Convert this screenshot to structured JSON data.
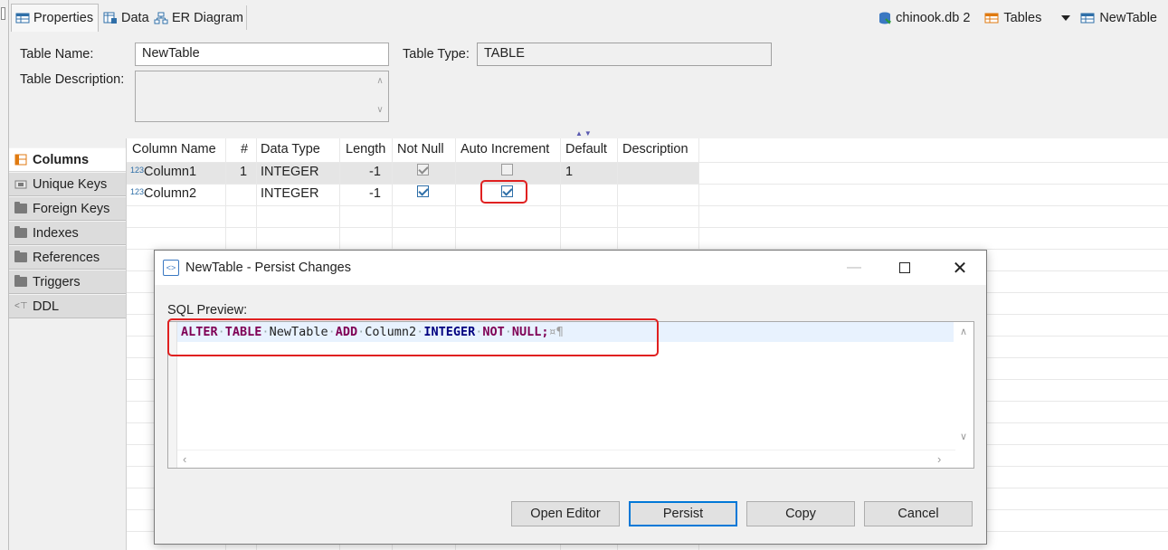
{
  "tabs": [
    {
      "label": "Properties",
      "icon": "table-icon"
    },
    {
      "label": "Data",
      "icon": "data-grid-icon"
    },
    {
      "label": "ER Diagram",
      "icon": "er-diagram-icon"
    }
  ],
  "breadcrumb": {
    "db": "chinook.db 2",
    "folder": "Tables",
    "table": "NewTable"
  },
  "form": {
    "table_name_label": "Table Name:",
    "table_name_value": "NewTable",
    "table_type_label": "Table Type:",
    "table_type_value": "TABLE",
    "table_description_label": "Table Description:",
    "table_description_value": ""
  },
  "sidenav": {
    "items": [
      {
        "label": "Columns",
        "icon": "columns-icon",
        "active": true
      },
      {
        "label": "Unique Keys",
        "icon": "key-icon",
        "active": false
      },
      {
        "label": "Foreign Keys",
        "icon": "folder-icon",
        "active": false
      },
      {
        "label": "Indexes",
        "icon": "folder-icon",
        "active": false
      },
      {
        "label": "References",
        "icon": "folder-icon",
        "active": false
      },
      {
        "label": "Triggers",
        "icon": "folder-icon",
        "active": false
      },
      {
        "label": "DDL",
        "icon": "ddl-icon",
        "active": false
      }
    ]
  },
  "grid": {
    "headers": [
      "Column Name",
      "#",
      "Data Type",
      "Length",
      "Not Null",
      "Auto Increment",
      "Default",
      "Description"
    ],
    "rows": [
      {
        "type_badge": "123",
        "name": "Column1",
        "ordinal": "1",
        "data_type": "INTEGER",
        "length": "-1",
        "not_null": true,
        "auto_increment": false,
        "default": "1",
        "description": ""
      },
      {
        "type_badge": "123",
        "name": "Column2",
        "ordinal": "",
        "data_type": "INTEGER",
        "length": "-1",
        "not_null": true,
        "auto_increment": true,
        "default": "",
        "description": ""
      }
    ]
  },
  "dialog": {
    "title": "NewTable - Persist Changes",
    "sql_label": "SQL Preview:",
    "sql": {
      "kw_alter": "ALTER",
      "kw_table": "TABLE",
      "table": "NewTable",
      "kw_add": "ADD",
      "column": "Column2",
      "kw_integer": "INTEGER",
      "kw_not": "NOT",
      "kw_null": "NULL",
      "semicolon": ";"
    },
    "buttons": {
      "open_editor": "Open Editor",
      "persist": "Persist",
      "copy": "Copy",
      "cancel": "Cancel"
    }
  },
  "colors": {
    "accent": "#0078d7",
    "highlight_red": "#e02020",
    "keyword": "#7f0055"
  }
}
